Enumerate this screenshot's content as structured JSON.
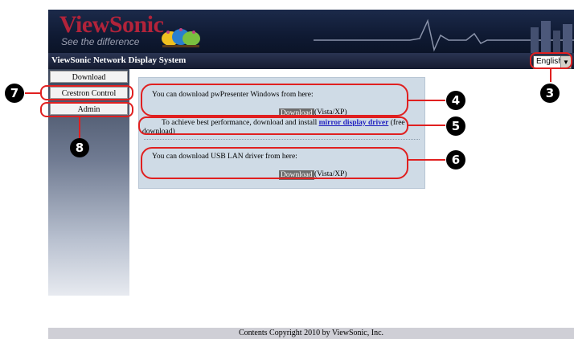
{
  "header": {
    "logo_text": "ViewSonic",
    "logo_tagline": "See the difference",
    "system_title": "ViewSonic Network Display System",
    "language": "English"
  },
  "sidebar": {
    "items": [
      {
        "label": "Download"
      },
      {
        "label": "Crestron Control"
      },
      {
        "label": "Admin"
      }
    ]
  },
  "main": {
    "pw_text": "You can download pwPresenter Windows from here:",
    "pw_button": "Download",
    "pw_os": "(Vista/XP)",
    "mirror_pre": "To achieve best performance, download and install",
    "mirror_link": "mirror display driver",
    "mirror_post1": "(free",
    "mirror_post2": "download)",
    "usb_text": "You can download USB LAN driver from here:",
    "usb_button": "Download",
    "usb_os": "(Vista/XP)"
  },
  "footer": {
    "copyright": "Contents Copyright 2010 by ViewSonic, Inc."
  },
  "callouts": [
    "3",
    "4",
    "5",
    "6",
    "7",
    "8"
  ],
  "colors": {
    "callout": "#e02020",
    "header_bg": "#1c2a4a",
    "logo": "#b2233a",
    "panel": "#cfdbe6",
    "link": "#1f1fbf"
  }
}
